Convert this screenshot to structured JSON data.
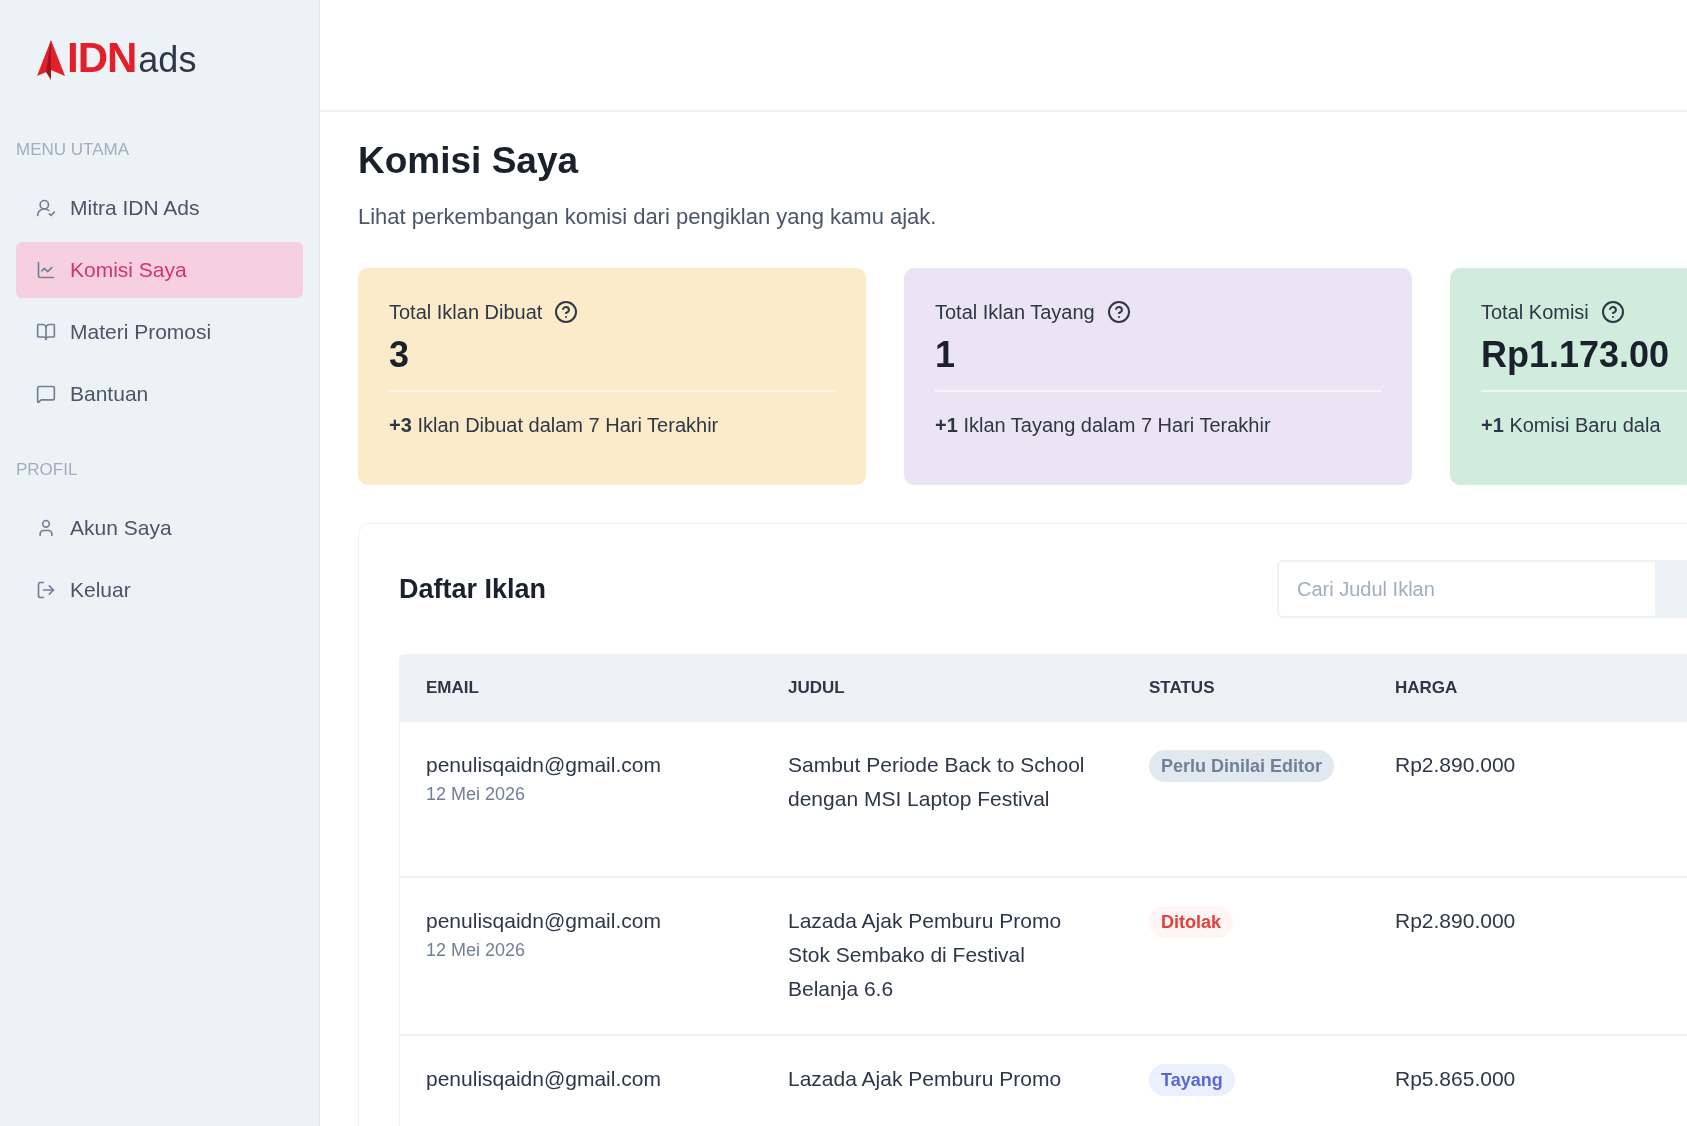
{
  "logo": {
    "brand": "IDN",
    "suffix": "ads"
  },
  "sidebar": {
    "sections": [
      {
        "heading": "MENU UTAMA",
        "items": [
          {
            "label": "Mitra IDN Ads",
            "selected": false
          },
          {
            "label": "Komisi Saya",
            "selected": true
          },
          {
            "label": "Materi Promosi",
            "selected": false
          },
          {
            "label": "Bantuan",
            "selected": false
          }
        ]
      },
      {
        "heading": "PROFIL",
        "items": [
          {
            "label": "Akun Saya",
            "selected": false
          },
          {
            "label": "Keluar",
            "selected": false
          }
        ]
      }
    ]
  },
  "page": {
    "title": "Komisi Saya",
    "subtitle": "Lihat perkembangan komisi dari pengiklan yang kamu ajak."
  },
  "stats": [
    {
      "label": "Total Iklan Dibuat",
      "value": "3",
      "delta": "+3",
      "note": "Iklan Dibuat dalam 7 Hari Terakhir",
      "color": "#fcebc9"
    },
    {
      "label": "Total Iklan Tayang",
      "value": "1",
      "delta": "+1",
      "note": "Iklan Tayang dalam 7 Hari Terakhir",
      "color": "#ebe4f3"
    },
    {
      "label": "Total Komisi",
      "value": "Rp1.173.00",
      "delta": "+1",
      "note": "Komisi Baru dala",
      "color": "#d0ecdc"
    }
  ],
  "ads": {
    "title": "Daftar Iklan",
    "search": {
      "placeholder": "Cari Judul Iklan"
    },
    "columns": [
      "EMAIL",
      "JUDUL",
      "STATUS",
      "HARGA"
    ],
    "rows": [
      {
        "email": "penulisqaidn@gmail.com",
        "date": "12 Mei 2026",
        "title": "Sambut Periode Back to School dengan MSI Laptop Festival",
        "status": "Perlu Dinilai Editor",
        "kind": "review",
        "price": "Rp2.890.000"
      },
      {
        "email": "penulisqaidn@gmail.com",
        "date": "12 Mei 2026",
        "title": "Lazada Ajak Pemburu Promo Stok Sembako di Festival Belanja 6.6",
        "status": "Ditolak",
        "kind": "rejected",
        "price": "Rp2.890.000"
      },
      {
        "email": "penulisqaidn@gmail.com",
        "title": "Lazada Ajak Pemburu Promo",
        "status": "Tayang",
        "kind": "live",
        "price": "Rp5.865.000"
      }
    ]
  }
}
